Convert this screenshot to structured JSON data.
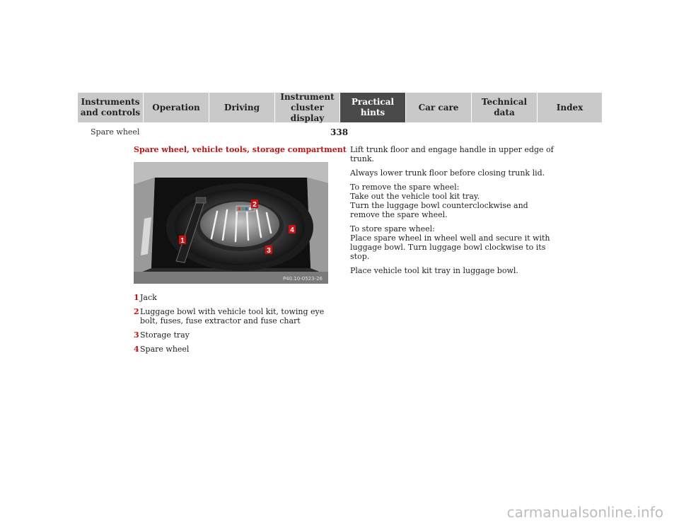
{
  "nav": {
    "tabs": [
      {
        "label": "Instruments\nand controls"
      },
      {
        "label": "Operation"
      },
      {
        "label": "Driving"
      },
      {
        "label": "Instrument\ncluster display"
      },
      {
        "label": "Practical hints"
      },
      {
        "label": "Car care"
      },
      {
        "label": "Technical\ndata"
      },
      {
        "label": "Index"
      }
    ],
    "active_tab": "Practical hints"
  },
  "page": {
    "number": "338",
    "section_title": "Spare wheel"
  },
  "content": {
    "heading": "Spare wheel, vehicle tools, storage compartment",
    "figure": {
      "code": "P40.10-0523-26",
      "callouts": [
        "1",
        "2",
        "3",
        "4"
      ]
    },
    "legend": [
      {
        "num": "1",
        "text": "Jack"
      },
      {
        "num": "2",
        "text": "Luggage bowl with vehicle tool kit, towing eye bolt, fuses, fuse extractor and fuse chart"
      },
      {
        "num": "3",
        "text": "Storage tray"
      },
      {
        "num": "4",
        "text": "Spare wheel"
      }
    ],
    "paragraphs": [
      "Lift trunk floor and engage handle in upper edge of trunk.",
      "Always lower trunk floor before closing trunk lid.",
      "To remove the spare wheel:\nTake out the vehicle tool kit tray.\nTurn the luggage bowl counterclockwise and remove the spare wheel.",
      "To store spare wheel:\nPlace spare wheel in wheel well and secure it with luggage bowl. Turn luggage bowl clockwise to its stop.",
      "Place vehicle tool kit tray in luggage bowl."
    ]
  },
  "watermark": "carmanualsonline.info",
  "colors": {
    "accent": "#d01010",
    "tab_bg": "#c9c9c9",
    "tab_active_bg": "#4a4a4a"
  }
}
